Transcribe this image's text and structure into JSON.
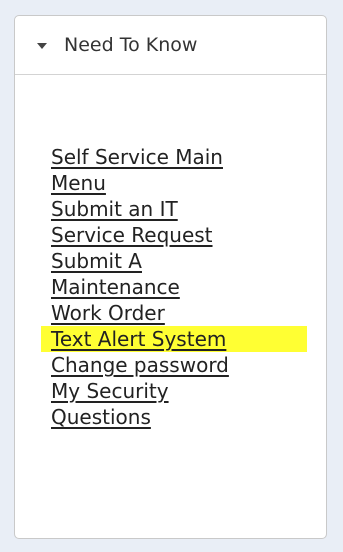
{
  "panel": {
    "title": "Need To Know",
    "toggle_icon": "triangle-down-icon"
  },
  "links": [
    {
      "lines": [
        "Self Service Main",
        "Menu"
      ]
    },
    {
      "lines": [
        "Submit an IT",
        "Service Request"
      ]
    },
    {
      "lines": [
        "Submit A",
        "Maintenance",
        "Work Order"
      ]
    },
    {
      "lines": [
        "Text Alert System"
      ],
      "highlighted": true
    },
    {
      "lines": [
        "Change password"
      ]
    },
    {
      "lines": [
        "My Security",
        "Questions"
      ]
    }
  ],
  "colors": {
    "background": "#e9eef6",
    "panel": "#ffffff",
    "link": "#222222",
    "highlight": "#ffff33"
  }
}
